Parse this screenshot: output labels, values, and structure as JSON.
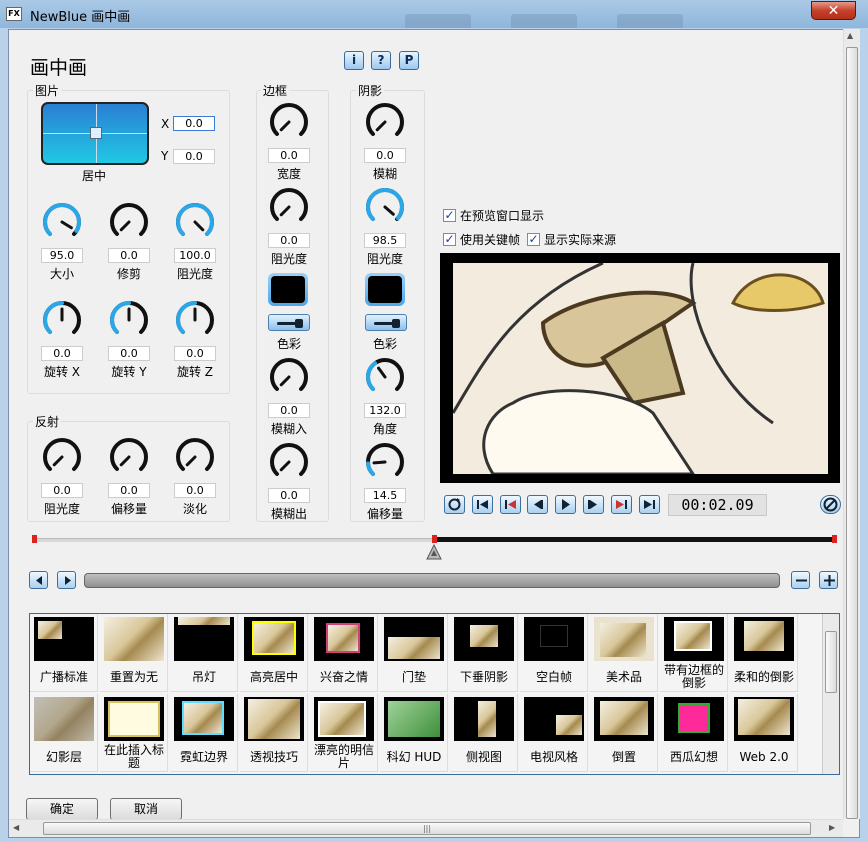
{
  "window": {
    "title": "NewBlue 画中画",
    "app_icon": "FX",
    "close_glyph": "✕"
  },
  "header": {
    "title": "画中画",
    "info_button": "i",
    "help_button": "?",
    "preset_button": "P"
  },
  "picture": {
    "title": "图片",
    "position_label": "居中",
    "x_label": "X",
    "x_value": "0.0",
    "y_label": "Y",
    "y_value": "0.0",
    "knobs": [
      {
        "label": "大小",
        "value": "95.0"
      },
      {
        "label": "修剪",
        "value": "0.0"
      },
      {
        "label": "阻光度",
        "value": "100.0"
      },
      {
        "label": "旋转 X",
        "value": "0.0"
      },
      {
        "label": "旋转 Y",
        "value": "0.0"
      },
      {
        "label": "旋转 Z",
        "value": "0.0"
      }
    ]
  },
  "reflection": {
    "title": "反射",
    "knobs": [
      {
        "label": "阻光度",
        "value": "0.0"
      },
      {
        "label": "偏移量",
        "value": "0.0"
      },
      {
        "label": "淡化",
        "value": "0.0"
      }
    ]
  },
  "border": {
    "title": "边框",
    "width": {
      "label": "宽度",
      "value": "0.0"
    },
    "opacity": {
      "label": "阻光度",
      "value": "0.0"
    },
    "color_label": "色彩",
    "blur_in": {
      "label": "模糊入",
      "value": "0.0"
    },
    "blur_out": {
      "label": "模糊出",
      "value": "0.0"
    }
  },
  "shadow": {
    "title": "阴影",
    "blur": {
      "label": "模糊",
      "value": "0.0"
    },
    "opacity": {
      "label": "阻光度",
      "value": "98.5"
    },
    "color_label": "色彩",
    "angle": {
      "label": "角度",
      "value": "132.0"
    },
    "offset": {
      "label": "偏移量",
      "value": "14.5"
    }
  },
  "preview": {
    "show_in_preview": "在预览窗口显示",
    "use_keyframes": "使用关键帧",
    "show_actual_source": "显示实际来源",
    "timecode": "00:02.09"
  },
  "presets": [
    "广播标准",
    "重置为无",
    "吊灯",
    "高亮居中",
    "兴奋之情",
    "门垫",
    "下垂阴影",
    "空白帧",
    "美术品",
    "带有边框的倒影",
    "柔和的倒影",
    "幻影层",
    "在此插入标题",
    "霓虹边界",
    "透视技巧",
    "漂亮的明信片",
    "科幻 HUD",
    "侧视图",
    "电视风格",
    "倒置",
    "西瓜幻想",
    "Web 2.0"
  ],
  "buttons": {
    "ok": "确定",
    "cancel": "取消"
  },
  "colors": {
    "knob_active": "#2aa7e8",
    "accent": "#1e6fbf"
  }
}
